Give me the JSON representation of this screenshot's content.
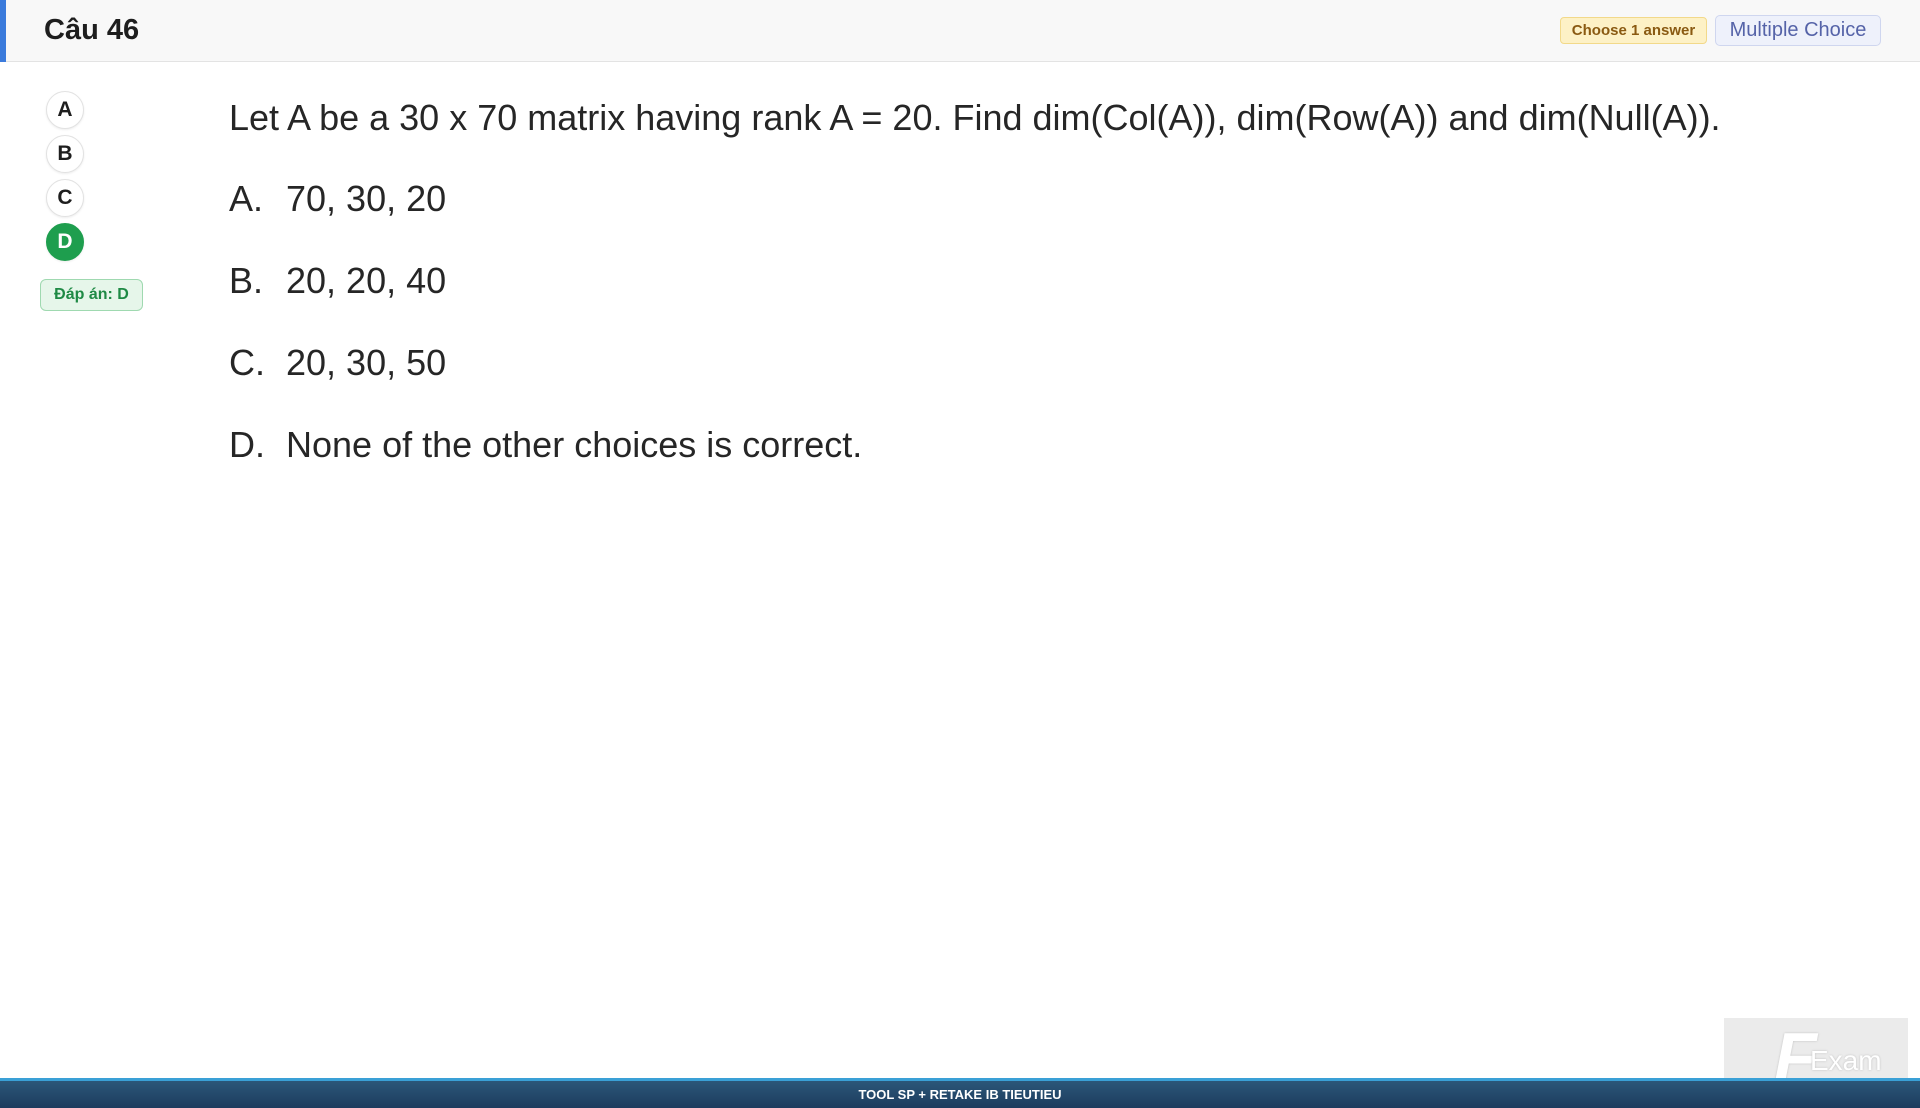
{
  "header": {
    "title": "Câu 46",
    "choose_tag": "Choose 1 answer",
    "type_tag": "Multiple Choice"
  },
  "answer_options": [
    {
      "letter": "A",
      "selected": false
    },
    {
      "letter": "B",
      "selected": false
    },
    {
      "letter": "C",
      "selected": false
    },
    {
      "letter": "D",
      "selected": true
    }
  ],
  "answer_badge": "Đáp án: D",
  "question": {
    "text": "Let A be a 30 x 70 matrix having rank A = 20. Find dim(Col(A)), dim(Row(A)) and dim(Null(A)).",
    "choices": [
      {
        "letter": "A.",
        "text": "70, 30, 20"
      },
      {
        "letter": "B.",
        "text": "20, 20, 40"
      },
      {
        "letter": "C.",
        "text": "20, 30, 50"
      },
      {
        "letter": "D.",
        "text": "None of the other choices is correct."
      }
    ]
  },
  "footer": {
    "text": "TOOL SP + RETAKE IB TIEUTIEU"
  },
  "logo": {
    "mark": "F",
    "word": "Exam"
  },
  "colors": {
    "accent": "#3b7bdc",
    "selected": "#1e9e4e",
    "footer": "#1d3b5e"
  }
}
